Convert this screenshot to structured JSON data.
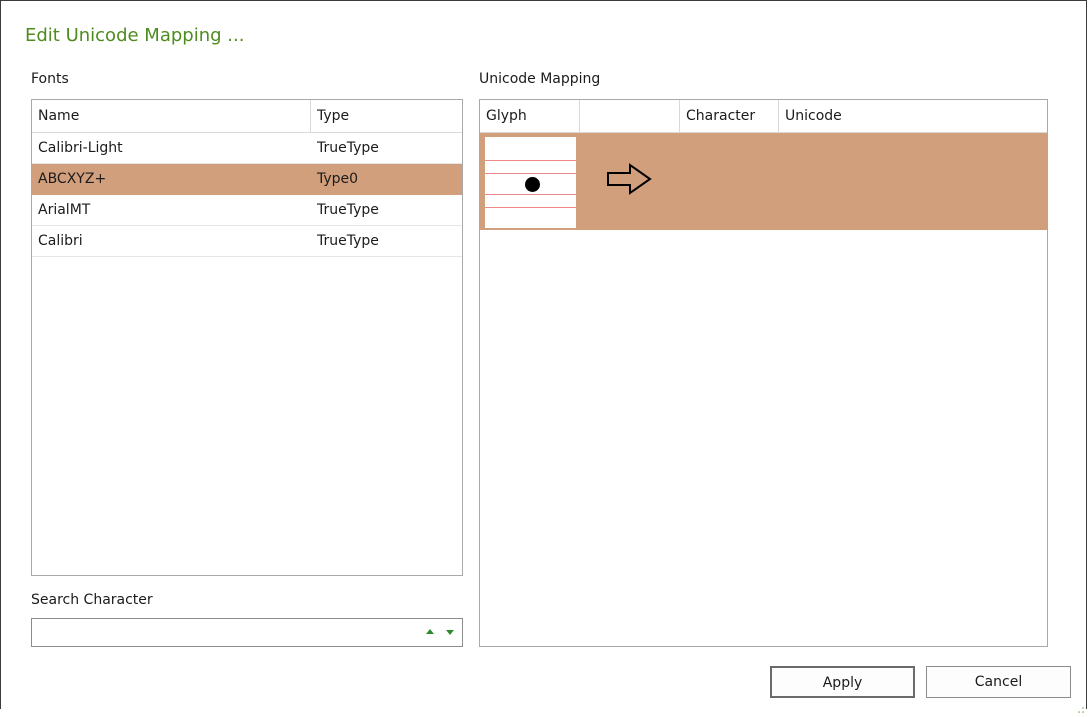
{
  "dialog": {
    "title": "Edit Unicode Mapping ..."
  },
  "fonts": {
    "label": "Fonts",
    "columns": [
      "Name",
      "Type"
    ],
    "rows": [
      {
        "name": "Calibri-Light",
        "type": "TrueType",
        "selected": false
      },
      {
        "name": "ABCXYZ+",
        "type": "Type0",
        "selected": true
      },
      {
        "name": "ArialMT",
        "type": "TrueType",
        "selected": false
      },
      {
        "name": "Calibri",
        "type": "TrueType",
        "selected": false
      }
    ]
  },
  "search": {
    "label": "Search Character",
    "value": "",
    "spin_up_icon": "triangle-up-icon",
    "spin_down_icon": "triangle-down-icon"
  },
  "mapping": {
    "label": "Unicode Mapping",
    "columns": [
      "Glyph",
      "",
      "Character",
      "Unicode"
    ],
    "rows": [
      {
        "glyph_icon": "bullet-glyph-icon",
        "arrow_icon": "right-arrow-outline-icon",
        "character": "",
        "unicode": "",
        "selected": true
      }
    ]
  },
  "buttons": {
    "apply": "Apply",
    "cancel": "Cancel"
  },
  "colors": {
    "title": "#4e8c1e",
    "selection": "#d19f7c",
    "spinner": "#2e8b2e"
  }
}
